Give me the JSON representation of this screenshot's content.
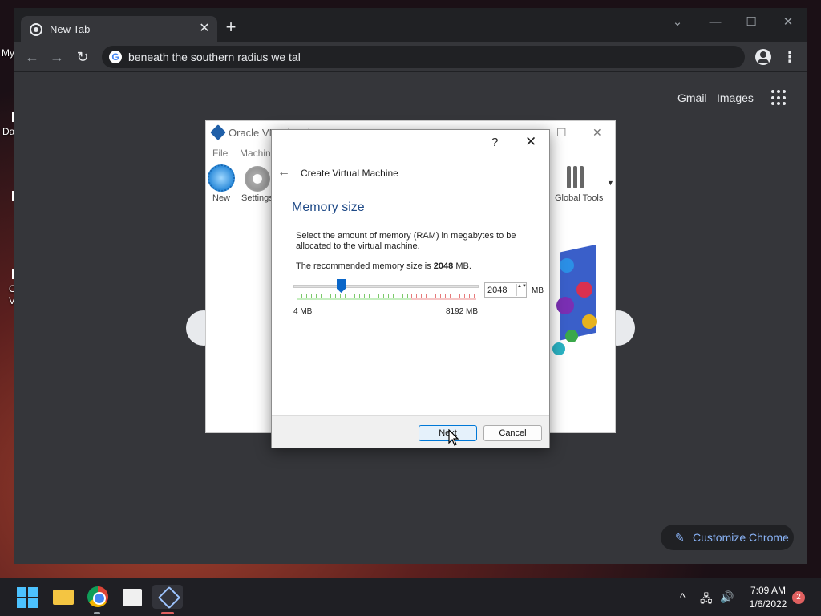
{
  "desktop": {
    "labels": [
      "My",
      "Da",
      "C",
      "V"
    ]
  },
  "browser": {
    "tab_title": "New Tab",
    "tab_close": "✕",
    "new_tab": "+",
    "window_controls": {
      "tabsearch": "⌄",
      "minimize": "—",
      "maximize": "☐",
      "close": "✕"
    },
    "nav": {
      "back": "←",
      "forward": "→",
      "reload": "↻"
    },
    "omnibox_text": "beneath the southern radius we tal",
    "menu": "⋮",
    "ntp": {
      "gmail": "Gmail",
      "images": "Images",
      "customize_label": "Customize Chrome",
      "customize_icon": "✎"
    }
  },
  "virtualbox": {
    "title": "Oracle VM VirtualBox M",
    "window_controls": {
      "maximize": "☐",
      "close": "✕"
    },
    "menu": [
      "File",
      "Machin"
    ],
    "tools": {
      "new": "New",
      "settings": "Settings",
      "global_tools": "Global Tools",
      "dropdown": "▼"
    }
  },
  "dialog": {
    "help": "?",
    "close": "✕",
    "back": "←",
    "header": "Create Virtual Machine",
    "page_title": "Memory size",
    "description": "Select the amount of memory (RAM) in megabytes to be allocated to the virtual machine.",
    "recommended_prefix": "The recommended memory size is ",
    "recommended_value": "2048",
    "recommended_suffix": " MB.",
    "slider": {
      "min_label": "4 MB",
      "max_label": "8192 MB",
      "min": 4,
      "max": 8192,
      "value": 2048
    },
    "spin_value": "2048",
    "spin_arrows": "▲▼",
    "unit": "MB",
    "next_label": "Next",
    "cancel_label": "Cancel"
  },
  "taskbar": {
    "clock_time": "7:09 AM",
    "clock_date": "1/6/2022",
    "notification_count": "2",
    "tray": {
      "chevron": "^",
      "network": "🖧",
      "volume": "🔊"
    }
  }
}
